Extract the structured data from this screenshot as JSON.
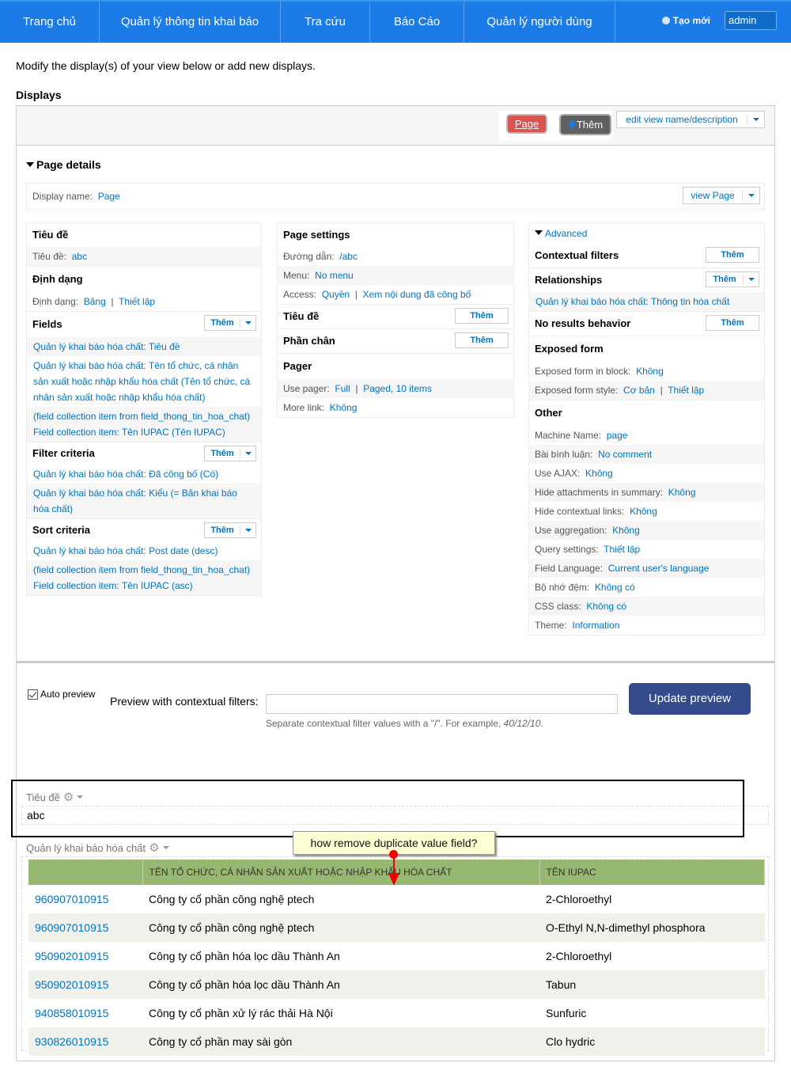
{
  "topnav": {
    "items": [
      "Trang chủ",
      "Quản lý thông tin khai báo",
      "Tra cứu",
      "Báo Cáo",
      "Quản lý người dùng"
    ],
    "create_new": "Tạo mới",
    "user": "admin"
  },
  "intro": "Modify the display(s) of your view below or add new displays.",
  "displays_heading": "Displays",
  "toolbar": {
    "page_tab": "Page",
    "add_label": "Thêm",
    "edit_view": "edit view name/description"
  },
  "page_details": {
    "heading": "Page details",
    "display_name_label": "Display name:",
    "display_name_value": "Page",
    "view_page": "view Page"
  },
  "col1": {
    "title_h": "Tiêu đề",
    "title_label": "Tiêu đề:",
    "title_value": "abc",
    "format_h": "Định dạng",
    "format_label": "Định dạng:",
    "format_value": "Bảng",
    "format_settings": "Thiết lập",
    "fields_h": "Fields",
    "fields": [
      "Quản lý khai báo hóa chất: Tiêu đề",
      "Quản lý khai báo hóa chất: Tên tổ chức, cá nhân sản xuất hoặc nhập khẩu hóa chất (Tên tổ chức, cá nhân sản xuất hoặc nhập khẩu hóa chất)",
      "(field collection item from field_thong_tin_hoa_chat) Field collection item: Tên IUPAC (Tên IUPAC)"
    ],
    "filter_h": "Filter criteria",
    "filters": [
      "Quản lý khai báo hóa chất: Đã công bố (Có)",
      "Quản lý khai báo hóa chất: Kiểu (= Bản khai báo hóa chất)"
    ],
    "sort_h": "Sort criteria",
    "sorts": [
      "Quản lý khai báo hóa chất: Post date (desc)",
      "(field collection item from field_thong_tin_hoa_chat) Field collection item: Tên IUPAC (asc)"
    ],
    "add": "Thêm"
  },
  "col2": {
    "page_settings_h": "Page settings",
    "path_label": "Đường dẫn:",
    "path_value": "/abc",
    "menu_label": "Menu:",
    "menu_value": "No menu",
    "access_label": "Access:",
    "access_value": "Quyền",
    "access_detail": "Xem nội dung đã công bố",
    "header_h": "Tiêu đề",
    "footer_h": "Phần chân",
    "pager_h": "Pager",
    "use_pager_label": "Use pager:",
    "use_pager_value": "Full",
    "use_pager_detail": "Paged, 10 items",
    "more_link_label": "More link:",
    "more_link_value": "Không",
    "add": "Thêm"
  },
  "col3": {
    "advanced": "Advanced",
    "contextual_h": "Contextual filters",
    "relationships_h": "Relationships",
    "relationship_item": "Quản lý khai báo hóa chất: Thông tin hóa chất",
    "no_results_h": "No results behavior",
    "exposed_h": "Exposed form",
    "exposed_block_label": "Exposed form in block:",
    "exposed_block_value": "Không",
    "exposed_style_label": "Exposed form style:",
    "exposed_style_value": "Cơ bản",
    "exposed_style_settings": "Thiết lập",
    "other_h": "Other",
    "other": [
      {
        "label": "Machine Name:",
        "value": "page"
      },
      {
        "label": "Bài bình luận:",
        "value": "No comment"
      },
      {
        "label": "Use AJAX:",
        "value": "Không"
      },
      {
        "label": "Hide attachments in summary:",
        "value": "Không"
      },
      {
        "label": "Hide contextual links:",
        "value": "Không"
      },
      {
        "label": "Use aggregation:",
        "value": "Không"
      },
      {
        "label": "Query settings:",
        "value": "Thiết lập"
      },
      {
        "label": "Field Language:",
        "value": "Current user's language"
      },
      {
        "label": "Bộ nhớ đệm:",
        "value": "Không có"
      },
      {
        "label": "CSS class:",
        "value": "Không có"
      },
      {
        "label": "Theme:",
        "value": "Information"
      }
    ],
    "add": "Thêm"
  },
  "preview": {
    "auto_preview": "Auto preview",
    "auto_preview_checked": true,
    "contextual_label": "Preview with contextual filters:",
    "contextual_value": "",
    "help_prefix": "Separate contextual filter values with a \"/\". For example, ",
    "help_example": "40/12/10",
    "help_suffix": ".",
    "update_button": "Update preview"
  },
  "result": {
    "title_label": "Tiêu đề",
    "title_value": "abc",
    "view_label": "Quản lý khai báo hóa chất",
    "columns": [
      "",
      "TÊN TỔ CHỨC, CÁ NHÂN SẢN XUẤT HOẶC NHẬP KHẨU HÓA CHẤT",
      "TÊN IUPAC"
    ],
    "rows": [
      [
        "960907010915",
        "Công ty cổ phần công nghệ ptech",
        "2-Chloroethyl"
      ],
      [
        "960907010915",
        "Công ty cổ phần công nghệ ptech",
        "O-Ethyl N,N-dimethyl phosphora"
      ],
      [
        "950902010915",
        "Công ty cổ phần hóa lọc dầu Thành An",
        "2-Chloroethyl"
      ],
      [
        "950902010915",
        "Công ty cổ phần hóa lọc dầu Thành An",
        "Tabun"
      ],
      [
        "940858010915",
        "Công ty cổ phần xử lý rác thải Hà Nội",
        "Sunfuric"
      ],
      [
        "930826010915",
        "Công ty cổ phần may sài gòn",
        "Clo hydric"
      ]
    ]
  },
  "annotation": {
    "note": "how remove duplicate value field?",
    "color": "#ee0000"
  }
}
